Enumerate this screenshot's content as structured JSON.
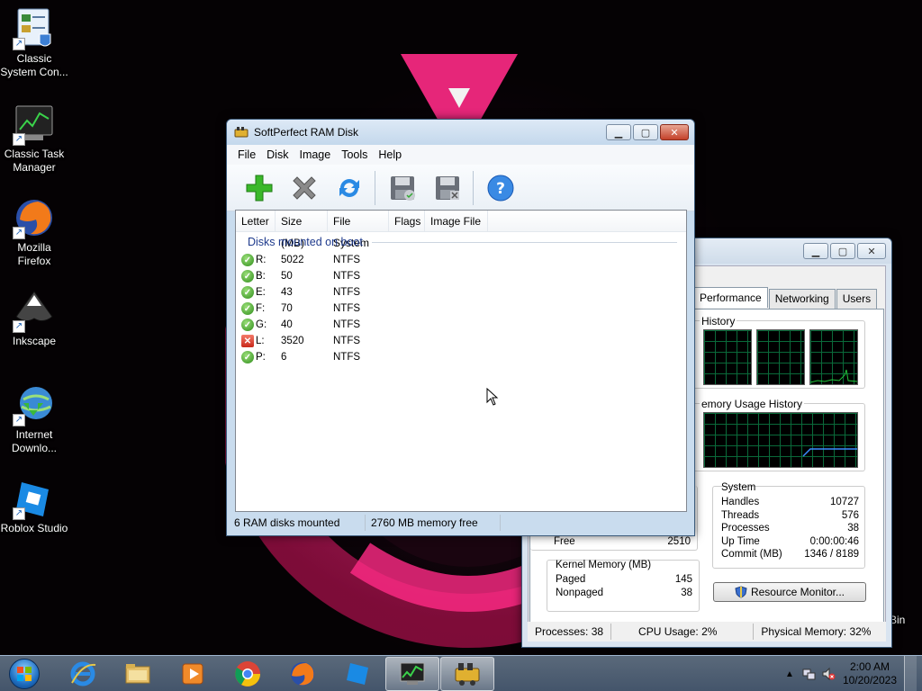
{
  "desktop": {
    "icons": [
      {
        "label_line1": "Classic",
        "label_line2": "System Con..."
      },
      {
        "label_line1": "Classic Task",
        "label_line2": "Manager"
      },
      {
        "label_line1": "Mozilla",
        "label_line2": "Firefox"
      },
      {
        "label_line1": "Inkscape",
        "label_line2": ""
      },
      {
        "label_line1": "Internet",
        "label_line2": "Downlo..."
      },
      {
        "label_line1": "Roblox Studio",
        "label_line2": ""
      }
    ],
    "partial_right_label": "Bin"
  },
  "ramdisk": {
    "title": "SoftPerfect RAM Disk",
    "menu": [
      "File",
      "Disk",
      "Image",
      "Tools",
      "Help"
    ],
    "toolbar": [
      "add-disk",
      "remove-disk",
      "refresh",
      "save-image",
      "discard-image",
      "help"
    ],
    "columns": [
      "Letter",
      "Size (MB)",
      "File System",
      "Flags",
      "Image File"
    ],
    "group": "Disks mounted on boot",
    "rows": [
      {
        "status": "ok",
        "letter": "R:",
        "size": "5022",
        "fs": "NTFS"
      },
      {
        "status": "ok",
        "letter": "B:",
        "size": "50",
        "fs": "NTFS"
      },
      {
        "status": "ok",
        "letter": "E:",
        "size": "43",
        "fs": "NTFS"
      },
      {
        "status": "ok",
        "letter": "F:",
        "size": "70",
        "fs": "NTFS"
      },
      {
        "status": "ok",
        "letter": "G:",
        "size": "40",
        "fs": "NTFS"
      },
      {
        "status": "err",
        "letter": "L:",
        "size": "3520",
        "fs": "NTFS"
      },
      {
        "status": "ok",
        "letter": "P:",
        "size": "6",
        "fs": "NTFS"
      }
    ],
    "status_left": "6 RAM disks mounted",
    "status_right": "2760 MB memory free"
  },
  "taskmgr": {
    "tabs": [
      "Performance",
      "Networking",
      "Users"
    ],
    "cpu_history_label": "History",
    "mem_history_label": "emory Usage History",
    "free_label": "Free",
    "free_value": "2510",
    "kernel_title": "Kernel Memory (MB)",
    "kernel": [
      {
        "k": "Paged",
        "v": "145"
      },
      {
        "k": "Nonpaged",
        "v": "38"
      }
    ],
    "system_title": "System",
    "system": [
      {
        "k": "Handles",
        "v": "10727"
      },
      {
        "k": "Threads",
        "v": "576"
      },
      {
        "k": "Processes",
        "v": "38"
      },
      {
        "k": "Up Time",
        "v": "0:00:00:46"
      },
      {
        "k": "Commit (MB)",
        "v": "1346 / 8189"
      }
    ],
    "resource_button": "Resource Monitor...",
    "status": [
      "Processes: 38",
      "CPU Usage: 2%",
      "Physical Memory: 32%"
    ]
  },
  "taskbar": {
    "apps": [
      "internet-explorer",
      "file-explorer",
      "media-player",
      "chrome",
      "firefox",
      "roblox-studio",
      "task-manager",
      "ram-disk"
    ],
    "time": "2:00 AM",
    "date": "10/20/2023"
  },
  "colors": {
    "accent_pink": "#ff2a86",
    "tm_graph_green": "#21c43a"
  }
}
